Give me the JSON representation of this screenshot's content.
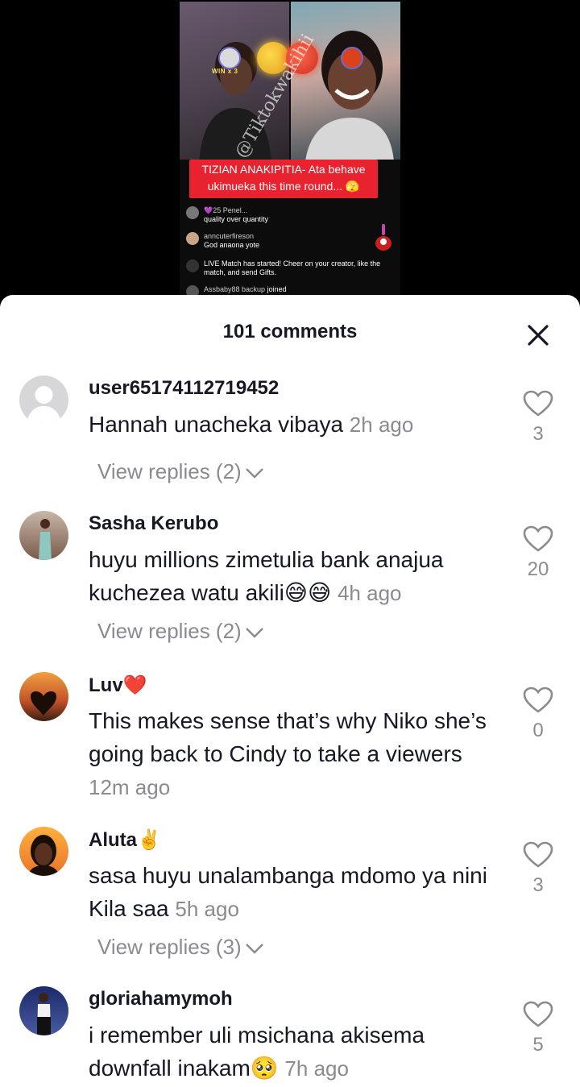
{
  "video": {
    "win_badge": "WIN x 3",
    "watermark": "@Tiktokwakihii",
    "caption": "TIZIAN ANAKIPITIA- Ata behave ukimueka this time round... 🫣",
    "chat": [
      {
        "name": "💜25 Penel...",
        "text": "quality over quantity"
      },
      {
        "name": "anncuterfireson",
        "text": "God anaona yote"
      },
      {
        "name": "",
        "text": "LIVE Match has started! Cheer on your creator, like the match, and send Gifts."
      },
      {
        "name": "Assbaby88 backup",
        "text": "joined"
      }
    ]
  },
  "sheet": {
    "title": "101 comments",
    "close_icon": "close-icon"
  },
  "comments": [
    {
      "user": "user65174112719452",
      "text": "Hannah unacheka vibaya",
      "time": "2h ago",
      "likes": "3",
      "replies": "View replies (2)",
      "avatar_color": "#d7d7d9"
    },
    {
      "user": "Sasha Kerubo",
      "text": "huyu millions zimetulia bank anajua kuchezea watu akili😅😅",
      "time": "4h ago",
      "likes": "20",
      "replies": "View replies (2)",
      "avatar_color": "#8a6a5a"
    },
    {
      "user": "Luv❤️",
      "text": "This makes sense that’s why Niko she’s going back to Cindy to take a viewers",
      "time": "12m ago",
      "likes": "0",
      "replies": "",
      "avatar_color": "#c86a2a"
    },
    {
      "user": "Aluta✌️",
      "text": "sasa huyu unalambanga mdomo ya nini Kila saa",
      "time": "5h ago",
      "likes": "3",
      "replies": "View replies (3)",
      "avatar_color": "#e9742a"
    },
    {
      "user": "gloriahamymoh",
      "text": "i remember uli msichana akisema downfall inakam🥺",
      "time": "7h ago",
      "likes": "5",
      "replies": "",
      "avatar_color": "#2a3a7a"
    }
  ]
}
